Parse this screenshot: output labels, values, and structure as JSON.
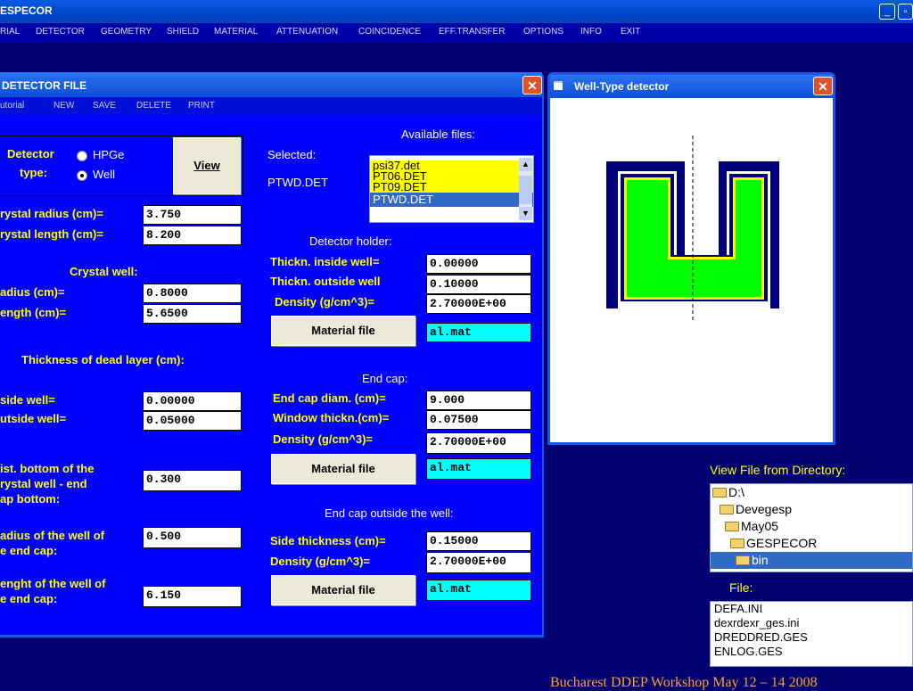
{
  "app": {
    "title": "ESPECOR"
  },
  "menu": [
    "RIAL",
    "DETECTOR",
    "GEOMETRY",
    "SHIELD",
    "MATERIAL",
    "ATTENUATION",
    "COINCIDENCE",
    "EFF.TRANSFER",
    "OPTIONS",
    "INFO",
    "EXIT"
  ],
  "detector_window": {
    "title": "DETECTOR FILE",
    "menu": [
      "utorial",
      "NEW",
      "SAVE",
      "DELETE",
      "PRINT"
    ],
    "detector_type_label_1": "Detector",
    "detector_type_label_2": "type:",
    "option_hpge": "HPGe",
    "option_well": "Well",
    "selected_type": "Well",
    "view_button": "View",
    "selected_label": "Selected:",
    "selected_value": "PTWD.DET",
    "available_label": "Available files:",
    "available_files": [
      "psi37.det",
      "PT06.DET",
      "PT09.DET",
      "PTWD.DET"
    ],
    "selected_file": "PTWD.DET",
    "crystal_radius_label": "rystal radius (cm)=",
    "crystal_radius": "3.750",
    "crystal_length_label": "rystal length (cm)=",
    "crystal_length": "8.200",
    "crystal_well_label": "Crystal well:",
    "well_radius_label": "adius (cm)=",
    "well_radius": "0.8000",
    "well_length_label": "ength (cm)=",
    "well_length": "5.6500",
    "dead_layer_label": "Thickness of dead layer (cm):",
    "inside_well_label": "side well=",
    "inside_well": "0.00000",
    "outside_well_label": "utside well=",
    "outside_well": "0.05000",
    "dist_bottom_label_1": "ist. bottom of the",
    "dist_bottom_label_2": "rystal well - end",
    "dist_bottom_label_3": "ap bottom:",
    "dist_bottom": "0.300",
    "endcap_well_radius_label_1": "adius of the well of",
    "endcap_well_radius_label_2": "e end cap:",
    "endcap_well_radius": "0.500",
    "endcap_well_length_label_1": "enght of the well of",
    "endcap_well_length_label_2": "e end cap:",
    "endcap_well_length": "6.150",
    "holder_label": "Detector holder:",
    "holder_inside_label": "Thickn. inside well=",
    "holder_inside": "0.00000",
    "holder_outside_label": "Thickn. outside well",
    "holder_outside": "0.10000",
    "holder_density_label": "Density (g/cm^3)=",
    "holder_density": "2.70000E+00",
    "material_file_button": "Material file",
    "holder_material": "al.mat",
    "endcap_label": "End cap:",
    "endcap_diam_label": "End cap diam. (cm)=",
    "endcap_diam": "9.000",
    "window_label": "Window thickn.(cm)=",
    "window_thickness": "0.07500",
    "endcap_density_label": "Density (g/cm^3)=",
    "endcap_density": "2.70000E+00",
    "endcap_material": "al.mat",
    "outside_label": "End cap outside the well:",
    "side_thickness_label": "Side thickness (cm)=",
    "side_thickness": "0.15000",
    "outside_density_label": "Density (g/cm^3)=",
    "outside_density": "2.70000E+00",
    "outside_material": "al.mat"
  },
  "well_window": {
    "title": "Well-Type detector"
  },
  "directory": {
    "label": "View File from Directory:",
    "items": [
      "D:\\",
      "Devegesp",
      "May05",
      "GESPECOR",
      "bin"
    ],
    "selected": "bin",
    "file_label": "File:",
    "files": [
      "DEFA.INI",
      "dexrdexr_ges.ini",
      "DREDDRED.GES",
      "ENLOG.GES"
    ]
  },
  "footer": "Bucharest DDEP Workshop May 12 – 14 2008",
  "colors": {
    "background": "#000070",
    "client": "#0000ff",
    "label": "#ffff00",
    "crystal": "#00ff00"
  }
}
